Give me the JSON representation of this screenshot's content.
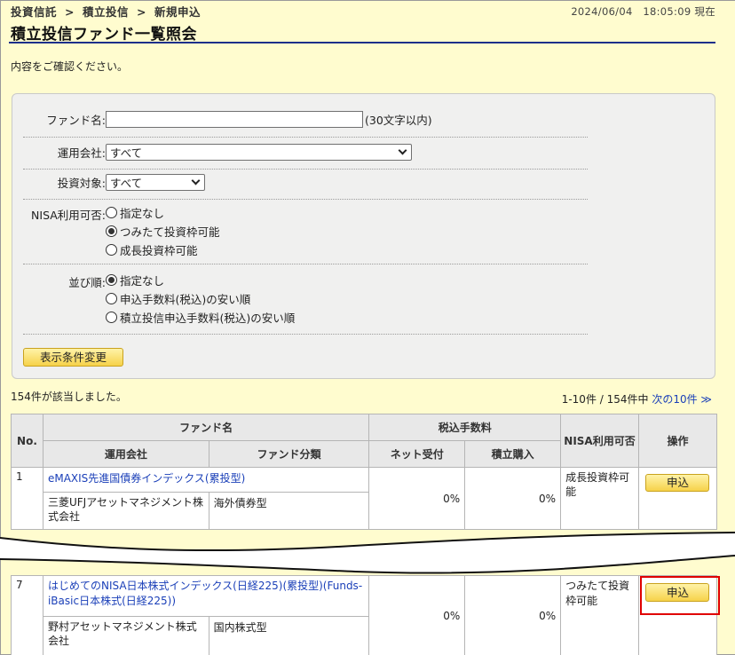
{
  "header": {
    "breadcrumb": [
      "投資信託",
      "積立投信",
      "新規申込"
    ],
    "breadcrumb_sep": ">",
    "datetime": "2024/06/04　18:05:09 現在",
    "title": "積立投信ファンド一覧照会",
    "intro": "内容をご確認ください。"
  },
  "search": {
    "fund_name_label": "ファンド名:",
    "fund_name_value": "",
    "fund_name_hint": "(30文字以内)",
    "company_label": "運用会社:",
    "company_value": "すべて",
    "target_label": "投資対象:",
    "target_value": "すべて",
    "nisa_label": "NISA利用可否:",
    "nisa_options": [
      "指定なし",
      "つみたて投資枠可能",
      "成長投資枠可能"
    ],
    "nisa_selected": 1,
    "sort_label": "並び順:",
    "sort_options": [
      "指定なし",
      "申込手数料(税込)の安い順",
      "積立投信申込手数料(税込)の安い順"
    ],
    "sort_selected": 0,
    "change_button": "表示条件変更"
  },
  "results": {
    "count_text": "154件が該当しました。",
    "range_text": "1-10件 / 154件中",
    "next_link": "次の10件 ≫"
  },
  "table": {
    "headers": {
      "no": "No.",
      "fund_name": "ファンド名",
      "company": "運用会社",
      "category": "ファンド分類",
      "fee_group": "税込手数料",
      "net": "ネット受付",
      "tsumitate": "積立購入",
      "nisa": "NISA利用可否",
      "action": "操作"
    },
    "rows": [
      {
        "no": "1",
        "name": "eMAXIS先進国債券インデックス(累投型)",
        "company": "三菱UFJアセットマネジメント株式会社",
        "category": "海外債券型",
        "net_fee": "0%",
        "tsumitate_fee": "0%",
        "nisa": "成長投資枠可能",
        "action": "申込"
      },
      {
        "no": "7",
        "name": "はじめてのNISA日本株式インデックス(日経225)(累投型)(Funds-iBasic日本株式(日経225))",
        "company": "野村アセットマネジメント株式会社",
        "category": "国内株式型",
        "net_fee": "0%",
        "tsumitate_fee": "0%",
        "nisa": "つみたて投資枠可能",
        "action": "申込"
      }
    ]
  },
  "colors": {
    "background": "#fffccf",
    "title_rule": "#1d2f8a",
    "link": "#1a3fb8",
    "button": "#f6d24a",
    "highlight": "#e00000"
  }
}
